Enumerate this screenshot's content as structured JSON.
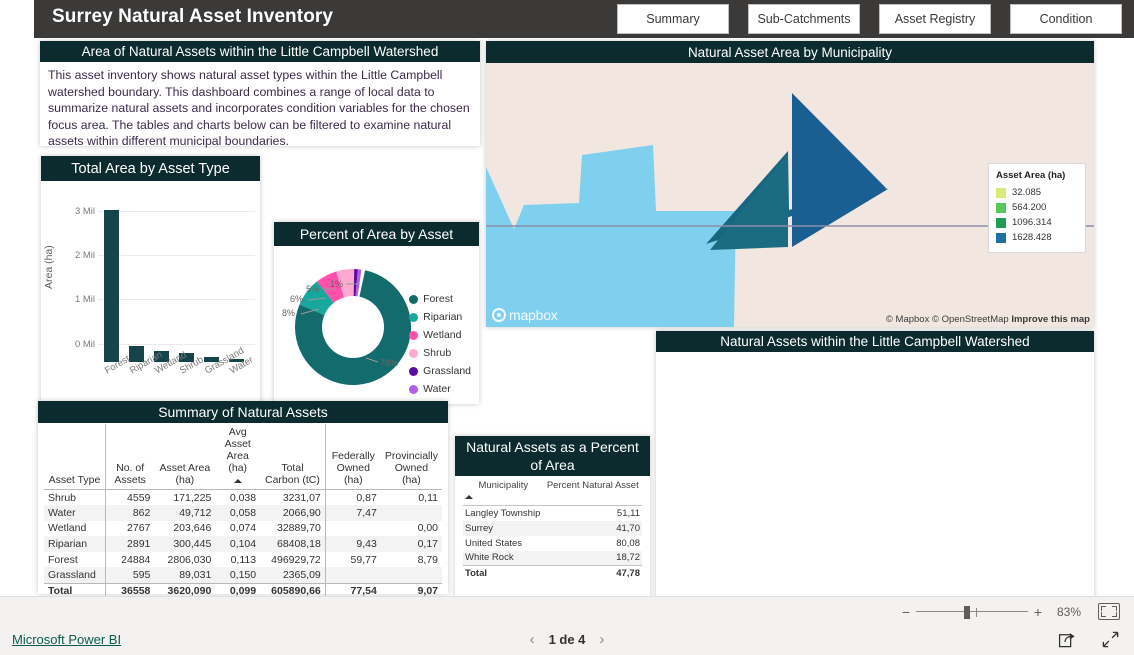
{
  "header": {
    "title": "Surrey Natural Asset Inventory",
    "nav_buttons": [
      {
        "label": "Summary"
      },
      {
        "label": "Sub-Catchments"
      },
      {
        "label": "Asset Registry"
      },
      {
        "label": "Condition"
      }
    ]
  },
  "description_card": {
    "title": "Area of Natural Assets within the Little Campbell Watershed",
    "body": "This asset inventory shows natural asset types within the Little Campbell watershed boundary. This dashboard combines a range of local data to summarize natural assets and incorporates condition variables for the chosen focus area. The tables and charts below can be filtered to examine natural assets within different municipal boundaries."
  },
  "map_card": {
    "title": "Natural Asset Area by Municipality",
    "logo_text": "mapbox",
    "attribution_mapbox": "© Mapbox",
    "attribution_osm": "© OpenStreetMap",
    "attribution_improve": "Improve this map",
    "legend": {
      "title": "Asset Area (ha)",
      "items": [
        {
          "label": "32.085",
          "color": "#dbea7d"
        },
        {
          "label": "564.200",
          "color": "#55c95a"
        },
        {
          "label": "1096.314",
          "color": "#1f9d55"
        },
        {
          "label": "1628.428",
          "color": "#1f6fa0"
        }
      ]
    }
  },
  "lower_right_panel": {
    "title": "Natural Assets within the Little Campbell Watershed"
  },
  "chart_data": [
    {
      "type": "bar",
      "title": "Total Area by Asset Type",
      "xlabel": "",
      "ylabel": "Area (ha)",
      "categories": [
        "Forest",
        "Riparian",
        "Wetland",
        "Shrub",
        "Grassland",
        "Water"
      ],
      "values": [
        2806030,
        300445,
        203646,
        171225,
        89031,
        49712
      ],
      "ylim": [
        0,
        3000000
      ],
      "yticks": [
        "0 Mil",
        "1 Mil",
        "2 Mil",
        "3 Mil"
      ],
      "grid": true,
      "bar_color": "#15444b"
    },
    {
      "type": "pie",
      "title": "Percent of Area by Asset",
      "legend_position": "right",
      "categories": [
        "Forest",
        "Riparian",
        "Wetland",
        "Shrub",
        "Grassland",
        "Water"
      ],
      "values": [
        78,
        8,
        6,
        5,
        1,
        1
      ],
      "labels": [
        "78%",
        "8%",
        "6%",
        "5%",
        "1%"
      ],
      "colors": [
        "#136b6e",
        "#16a89c",
        "#ff50ab",
        "#ffa8d0",
        "#5b0fa0",
        "#b25ce6"
      ]
    }
  ],
  "summary_table": {
    "title": "Summary of Natural Assets",
    "columns": [
      "Asset Type",
      "No. of Assets",
      "Asset Area (ha)",
      "Avg Asset Area (ha)",
      "Total Carbon (tC)",
      "Federally Owned (ha)",
      "Provincially Owned (ha)"
    ],
    "sorted_column": "Avg Asset Area (ha)",
    "rows": [
      {
        "type": "Shrub",
        "count": "4559",
        "area": "171,225",
        "avg": "0,038",
        "carbon": "3231,07",
        "federal": "0,87",
        "provincial": "0,11"
      },
      {
        "type": "Water",
        "count": "862",
        "area": "49,712",
        "avg": "0,058",
        "carbon": "2066,90",
        "federal": "7,47",
        "provincial": ""
      },
      {
        "type": "Wetland",
        "count": "2767",
        "area": "203,646",
        "avg": "0,074",
        "carbon": "32889,70",
        "federal": "",
        "provincial": "0,00"
      },
      {
        "type": "Riparian",
        "count": "2891",
        "area": "300,445",
        "avg": "0,104",
        "carbon": "68408,18",
        "federal": "9,43",
        "provincial": "0,17"
      },
      {
        "type": "Forest",
        "count": "24884",
        "area": "2806,030",
        "avg": "0,113",
        "carbon": "496929,72",
        "federal": "59,77",
        "provincial": "8,79"
      },
      {
        "type": "Grassland",
        "count": "595",
        "area": "89,031",
        "avg": "0,150",
        "carbon": "2365,09",
        "federal": "",
        "provincial": ""
      }
    ],
    "total": {
      "type": "Total",
      "count": "36558",
      "area": "3620,090",
      "avg": "0,099",
      "carbon": "605890,66",
      "federal": "77,54",
      "provincial": "9,07"
    }
  },
  "percent_table": {
    "title": "Natural Assets as a Percent of Area",
    "columns": [
      "Municipality",
      "Percent Natural Asset"
    ],
    "rows": [
      {
        "municipality": "Langley Township",
        "percent": "51,11"
      },
      {
        "municipality": "Surrey",
        "percent": "41,70"
      },
      {
        "municipality": "United States",
        "percent": "80,08"
      },
      {
        "municipality": "White Rock",
        "percent": "18,72"
      }
    ],
    "total": {
      "municipality": "Total",
      "percent": "47,78"
    }
  },
  "statusbar": {
    "zoom_minus": "−",
    "zoom_plus": "+",
    "zoom_value": "83%",
    "fit_icon": "fit-to-page-icon"
  },
  "footer": {
    "brand_link": "Microsoft Power BI",
    "prev_icon": "‹",
    "next_icon": "›",
    "page_label": "1 de 4",
    "share_icon": "share-icon",
    "fullscreen_icon": "fullscreen-icon"
  }
}
